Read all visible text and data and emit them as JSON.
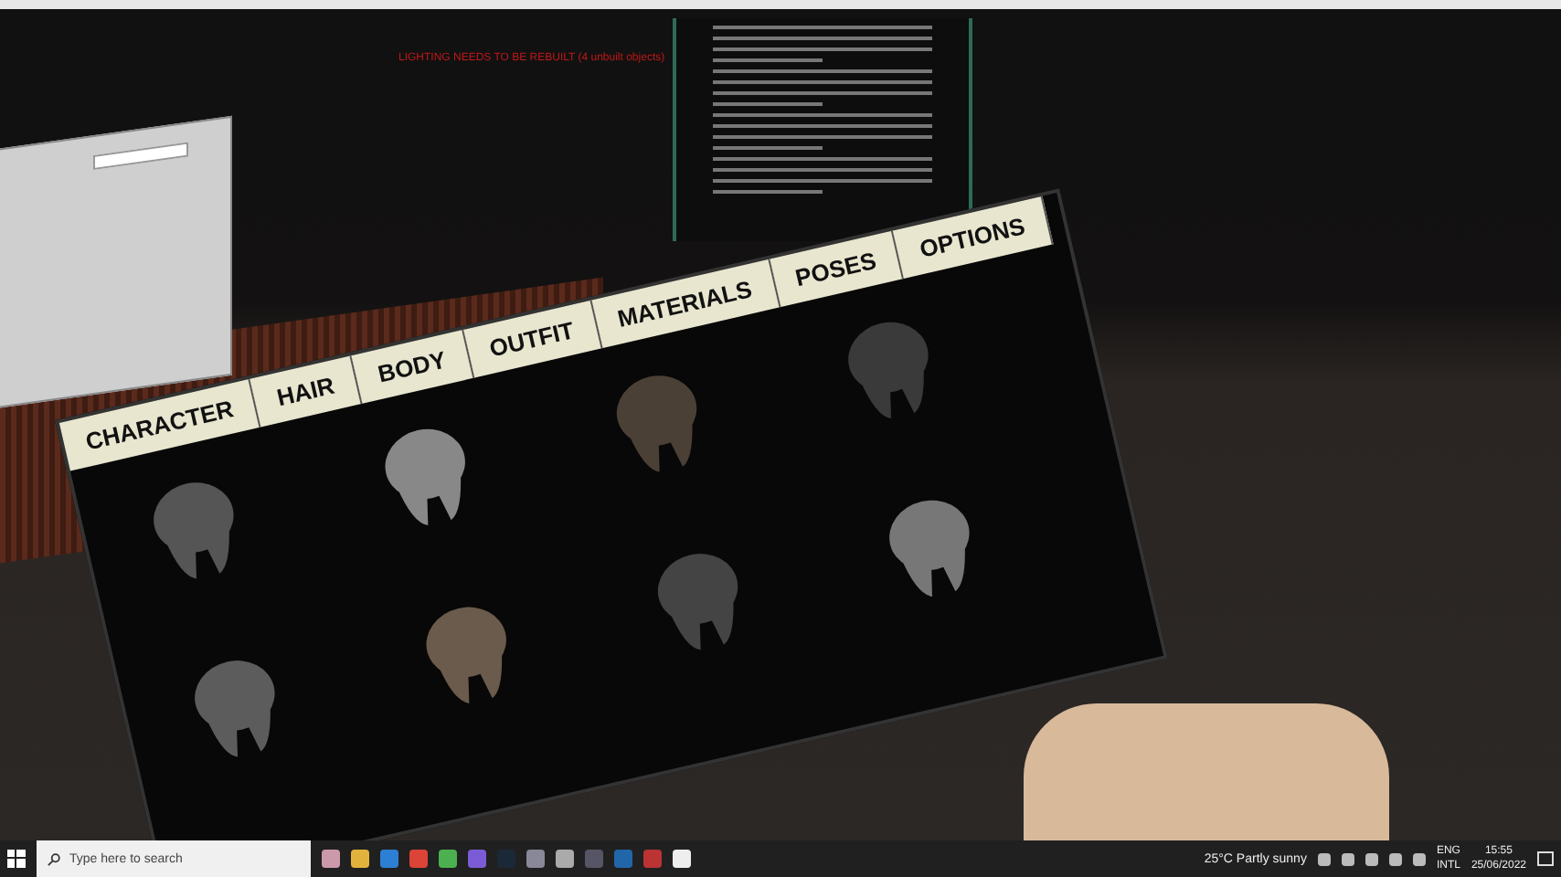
{
  "scene": {
    "warning": "LIGHTING NEEDS TO BE REBUILT (4 unbuilt objects)",
    "menu": {
      "tabs": [
        {
          "label": "CHARACTER"
        },
        {
          "label": "HAIR"
        },
        {
          "label": "BODY"
        },
        {
          "label": "OUTFIT"
        },
        {
          "label": "MATERIALS"
        },
        {
          "label": "POSES"
        },
        {
          "label": "OPTIONS"
        }
      ]
    }
  },
  "taskbar": {
    "search": {
      "placeholder": "Type here to search"
    },
    "weather": "25°C  Partly sunny",
    "language": [
      "ENG",
      "INTL"
    ],
    "time": "15:55",
    "date": "25/06/2022"
  }
}
